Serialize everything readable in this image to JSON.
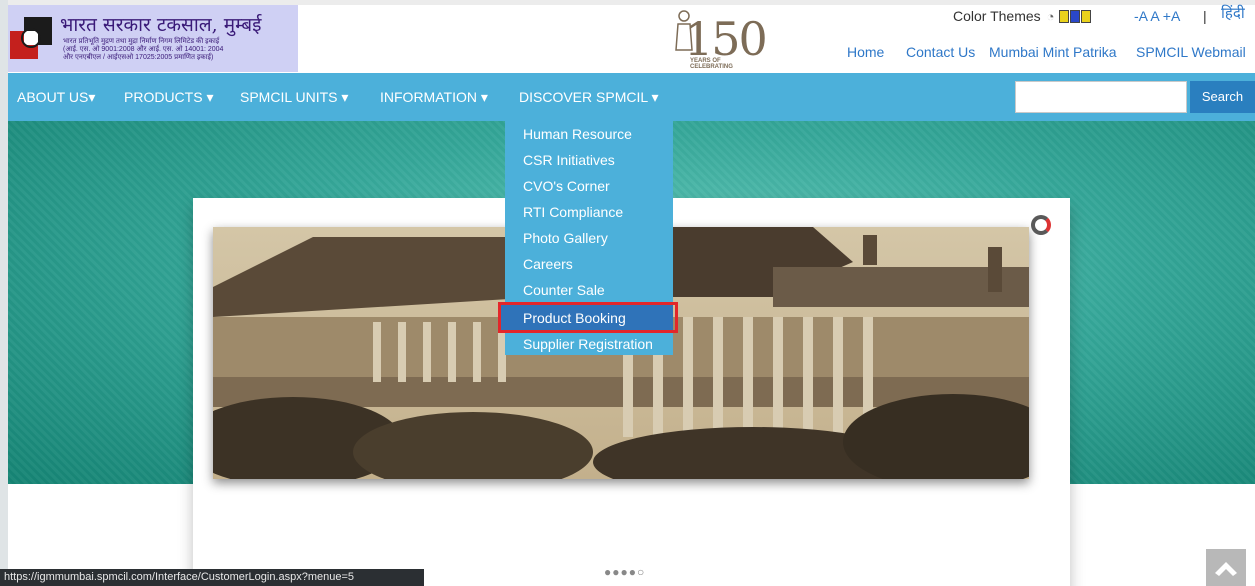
{
  "header": {
    "logo_title": "भारत सरकार टकसाल, मुम्बई",
    "logo_sub_1": "भारत प्रतिभूति मुद्रण तथा मुद्रा निर्माण निगम लिमिटेड की इकाई",
    "logo_sub_2": "(आई. एस. ओ 9001:2008 और आई. एस. ओ 14001: 2004",
    "logo_sub_3": "और एनएबीएल / आईएसओ 17025:2005 प्रमाणित इकाई)",
    "anniv_number": "150",
    "anniv_caption_1": "YEARS OF",
    "anniv_caption_2": "CELEBRATING",
    "color_themes_label": "Color Themes",
    "theme_swatches": [
      "#e9d21c",
      "#2a47c8",
      "#e9d21c"
    ],
    "font_size_controls": "-A A +A",
    "separator": "|",
    "hindi_label": "हिंदी",
    "links": {
      "home": "Home",
      "contact": "Contact Us",
      "patrika": "Mumbai Mint Patrika",
      "webmail": "SPMCIL Webmail"
    }
  },
  "nav": {
    "about": "ABOUT US▾",
    "products": "PRODUCTS ▾",
    "units": "SPMCIL UNITS ▾",
    "information": "INFORMATION ▾",
    "discover": "DISCOVER SPMCIL ▾",
    "search_button": "Search",
    "search_placeholder": ""
  },
  "dropdown": {
    "items": [
      "Human Resource",
      "CSR Initiatives",
      "CVO's Corner",
      "RTI Compliance",
      "Photo Gallery",
      "Careers",
      "Counter Sale",
      "Product Booking",
      "Supplier Registration"
    ],
    "active_item": "Product Booking"
  },
  "carousel": {
    "dots": "●●●●○"
  },
  "status_bar": {
    "url": "https://igmmumbai.spmcil.com/Interface/CustomerLogin.aspx?menue=5"
  },
  "colors": {
    "nav_bg": "#4cb0da",
    "active_item": "#2f73b9",
    "highlight_border": "#e3262a",
    "search_button": "#2a7fbf"
  },
  "icons": [
    "logo-mark-icon",
    "theme-circle-icon",
    "loader-icon",
    "arrow-up-icon"
  ]
}
